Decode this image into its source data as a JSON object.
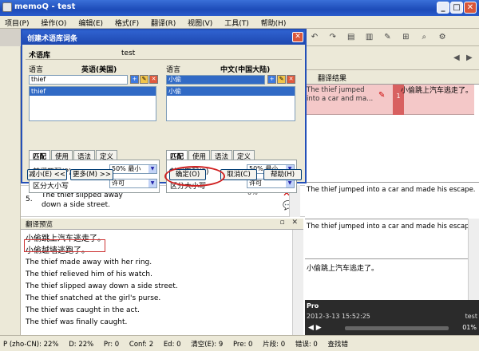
{
  "window": {
    "title": "memoQ - test",
    "controls": [
      "_",
      "□",
      "✕"
    ]
  },
  "menu": [
    "项目(P)",
    "操作(O)",
    "编辑(E)",
    "格式(F)",
    "翻译(R)",
    "视图(V)",
    "工具(T)",
    "帮助(H)"
  ],
  "right_header": {
    "column_label": "翻译结果"
  },
  "grid_row_1": {
    "source": "The thief jumped into a car and ma...",
    "number": "1",
    "target": "小偷跳上汽车逃走了。"
  },
  "grid_row_5": {
    "number": "5.",
    "source": "The thief slipped away down a side street.",
    "percent": "0%"
  },
  "result_panels": {
    "a": "The thief jumped into a car and made his escape.",
    "b": "The thief jumped into a car and made his escape.",
    "c": "小偷跳上汽车逃走了。"
  },
  "pro_panel": {
    "title": "Pro",
    "timestamp": "2012-3-13 15:52:25",
    "user": "test",
    "percent": "01%"
  },
  "preview": {
    "title": "翻译预览",
    "lines": [
      "小偷跳上汽车逃走了。",
      "小偷越墙逃跑了。",
      "The thief made away with her ring.",
      "The thief relieved him of his watch.",
      "The thief slipped away down a side street.",
      "The thief snatched at the girl's purse.",
      "The thief was caught in the act.",
      "The thief was finally caught."
    ]
  },
  "statusbar": {
    "items": [
      "P (zho-CN): 22%",
      "D: 22%",
      "Pr: 0",
      "Conf: 2",
      "Ed: 0",
      "清空(E): 9",
      "Pre: 0",
      "片段: 0",
      "错误: 0",
      "查找错"
    ]
  },
  "dialog": {
    "title": "创建术语库词条",
    "termbase_label": "术语库",
    "termbase_value": "test",
    "left": {
      "lang_label": "语言",
      "lang_name": "英语(美国)",
      "term_input": "thief",
      "list_item": "thief",
      "tabs": [
        "匹配",
        "使用",
        "语法",
        "定义"
      ],
      "prefix_label": "前缀匹配(P)",
      "prefix_value": "50% 最小",
      "case_label": "区分大小写",
      "case_value": "许可"
    },
    "right": {
      "lang_label": "语言",
      "lang_name": "中文(中国大陆)",
      "term_input": "小偷",
      "list_item": "小偷",
      "tabs": [
        "匹配",
        "使用",
        "语法",
        "定义"
      ],
      "prefix_label": "前缀匹配(P)",
      "prefix_value": "50% 最小",
      "case_label": "区分大小写",
      "case_value": "许可"
    },
    "buttons": {
      "less": "减小(E) <<",
      "more": "更多(M) >>",
      "ok": "确定(O)",
      "cancel": "取消(C)",
      "help": "帮助(H)"
    }
  }
}
